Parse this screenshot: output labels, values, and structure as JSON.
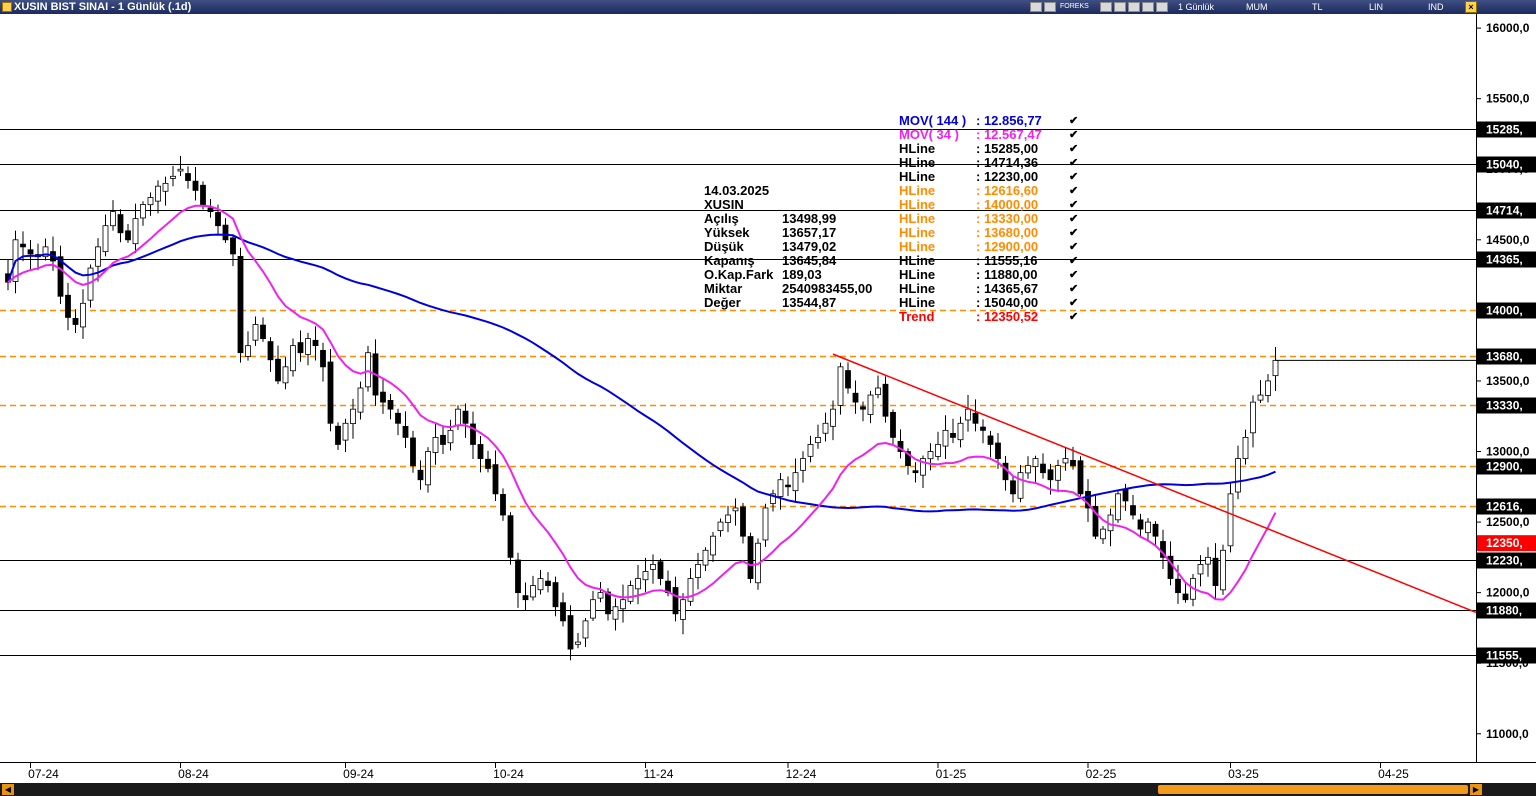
{
  "window": {
    "title": "XUSIN BIST SINAI - 1 Günlük (.1d)",
    "toolbar": {
      "broker": "FOREKS",
      "period": "1 Günlük",
      "chart_style": "MUM",
      "currency": "TL",
      "scale": "LIN",
      "mode": "IND"
    }
  },
  "info_panel": {
    "date": "14.03.2025",
    "symbol": "XUSIN",
    "rows": [
      {
        "label": "Açılış",
        "value": "13498,99"
      },
      {
        "label": "Yüksek",
        "value": "13657,17"
      },
      {
        "label": "Düşük",
        "value": "13479,02"
      },
      {
        "label": "Kapanış",
        "value": "13645,84"
      },
      {
        "label": "O.Kap.Fark",
        "value": "189,03"
      },
      {
        "label": "Miktar",
        "value": "2540983455,00"
      },
      {
        "label": "Değer",
        "value": "13544,87"
      }
    ]
  },
  "legend": [
    {
      "name": "MOV( 144 )",
      "value": ": 12.856,77",
      "color": "#0000dd"
    },
    {
      "name": "MOV( 34 )",
      "value": ": 12.567,47",
      "color": "#ee22ee"
    },
    {
      "name": "HLine",
      "value": ": 15285,00",
      "color": "#000000"
    },
    {
      "name": "HLine",
      "value": ": 14714,36",
      "color": "#000000"
    },
    {
      "name": "HLine",
      "value": ": 12230,00",
      "color": "#000000"
    },
    {
      "name": "HLine",
      "value": ": 12616,60",
      "color": "#ff8c00"
    },
    {
      "name": "HLine",
      "value": ": 14000,00",
      "color": "#ff8c00"
    },
    {
      "name": "HLine",
      "value": ": 13330,00",
      "color": "#ff8c00"
    },
    {
      "name": "HLine",
      "value": ": 13680,00",
      "color": "#ff8c00"
    },
    {
      "name": "HLine",
      "value": ": 12900,00",
      "color": "#ff8c00"
    },
    {
      "name": "HLine",
      "value": ": 11555,16",
      "color": "#000000"
    },
    {
      "name": "HLine",
      "value": ": 11880,00",
      "color": "#000000"
    },
    {
      "name": "HLine",
      "value": ": 14365,67",
      "color": "#000000"
    },
    {
      "name": "HLine",
      "value": ": 15040,00",
      "color": "#000000"
    },
    {
      "name": "Trend",
      "value": ": 12350,52",
      "color": "#ff0000"
    }
  ],
  "chart_data": {
    "type": "candlestick",
    "ylim": [
      10800,
      16100
    ],
    "y_ticks": [
      "16000,0",
      "15500,0",
      "15000,0",
      "14500,0",
      "14000,0",
      "13500,0",
      "13000,0",
      "12500,0",
      "12000,0",
      "11500,0",
      "11000,0"
    ],
    "x_ticks": [
      "07-24",
      "08-24",
      "09-24",
      "10-24",
      "11-24",
      "12-24",
      "01-25",
      "02-25",
      "03-25",
      "04-25"
    ],
    "hlines": [
      {
        "value": 15285,
        "style": "solid",
        "color": "#000000",
        "label": "15285,"
      },
      {
        "value": 15040,
        "style": "solid",
        "color": "#000000",
        "label": "15040,"
      },
      {
        "value": 14714.36,
        "style": "solid",
        "color": "#000000",
        "label": "14714,"
      },
      {
        "value": 14365.67,
        "style": "solid",
        "color": "#000000",
        "label": "14365,"
      },
      {
        "value": 14000,
        "style": "dashed",
        "color": "#ff8c00",
        "label": "14000,"
      },
      {
        "value": 13680,
        "style": "dashed",
        "color": "#ff8c00",
        "label": "13680,"
      },
      {
        "value": 13330,
        "style": "dashed",
        "color": "#ff8c00",
        "label": "13330,"
      },
      {
        "value": 12900,
        "style": "dashed",
        "color": "#ff8c00",
        "label": "12900,"
      },
      {
        "value": 12616.6,
        "style": "dashed",
        "color": "#ff8c00",
        "label": "12616,"
      },
      {
        "value": 12230,
        "style": "solid",
        "color": "#000000",
        "label": "12230,"
      },
      {
        "value": 11880,
        "style": "solid",
        "color": "#000000",
        "label": "11880,"
      },
      {
        "value": 11555.16,
        "style": "solid",
        "color": "#000000",
        "label": "11555,"
      }
    ],
    "trend_label": {
      "value": 12350.52,
      "label": "12350,",
      "color": "#ff0000"
    },
    "closes": [
      14200,
      14500,
      14450,
      14400,
      14380,
      14450,
      14350,
      14100,
      13950,
      13900,
      14050,
      14300,
      14450,
      14600,
      14700,
      14550,
      14500,
      14650,
      14750,
      14800,
      14880,
      14900,
      14950,
      15000,
      14920,
      14850,
      14750,
      14700,
      14600,
      14500,
      14400,
      13700,
      13750,
      13900,
      13800,
      13650,
      13500,
      13600,
      13750,
      13700,
      13800,
      13750,
      13600,
      13200,
      13050,
      13200,
      13300,
      13450,
      13700,
      13400,
      13350,
      13300,
      13200,
      13100,
      12900,
      12800,
      13000,
      13100,
      13050,
      13150,
      13300,
      13200,
      13050,
      12950,
      12880,
      12700,
      12550,
      12250,
      12000,
      11950,
      12050,
      12100,
      12050,
      11900,
      11800,
      11600,
      11650,
      11800,
      11950,
      12000,
      11850,
      11900,
      11950,
      12050,
      12100,
      12150,
      12200,
      12100,
      12000,
      11850,
      11950,
      12100,
      12200,
      12300,
      12400,
      12500,
      12550,
      12600,
      12400,
      12100,
      12350,
      12600,
      12700,
      12800,
      12750,
      12850,
      12950,
      13050,
      13100,
      13200,
      13300,
      13600,
      13450,
      13350,
      13300,
      13400,
      13450,
      13250,
      13100,
      13000,
      12900,
      12850,
      12950,
      13000,
      13050,
      13150,
      13100,
      13200,
      13300,
      13200,
      13150,
      13050,
      12950,
      12800,
      12700,
      12850,
      12900,
      12950,
      12850,
      12800,
      12900,
      12950,
      12900,
      12700,
      12600,
      12400,
      12450,
      12550,
      12700,
      12650,
      12550,
      12450,
      12500,
      12400,
      12250,
      12100,
      12000,
      11950,
      12100,
      12200,
      12250,
      12050,
      12300,
      12700,
      12950,
      13100,
      13350,
      13400,
      13500,
      13646
    ],
    "series": [
      {
        "name": "MOV( 144 )",
        "color": "#0000dd",
        "last": 12856.77
      },
      {
        "name": "MOV( 34 )",
        "color": "#ee22ee",
        "last": 12567.47
      }
    ],
    "trendline": {
      "start": {
        "value": 13690
      },
      "end_value_at_axis": 11860,
      "color": "#ff0000"
    }
  }
}
